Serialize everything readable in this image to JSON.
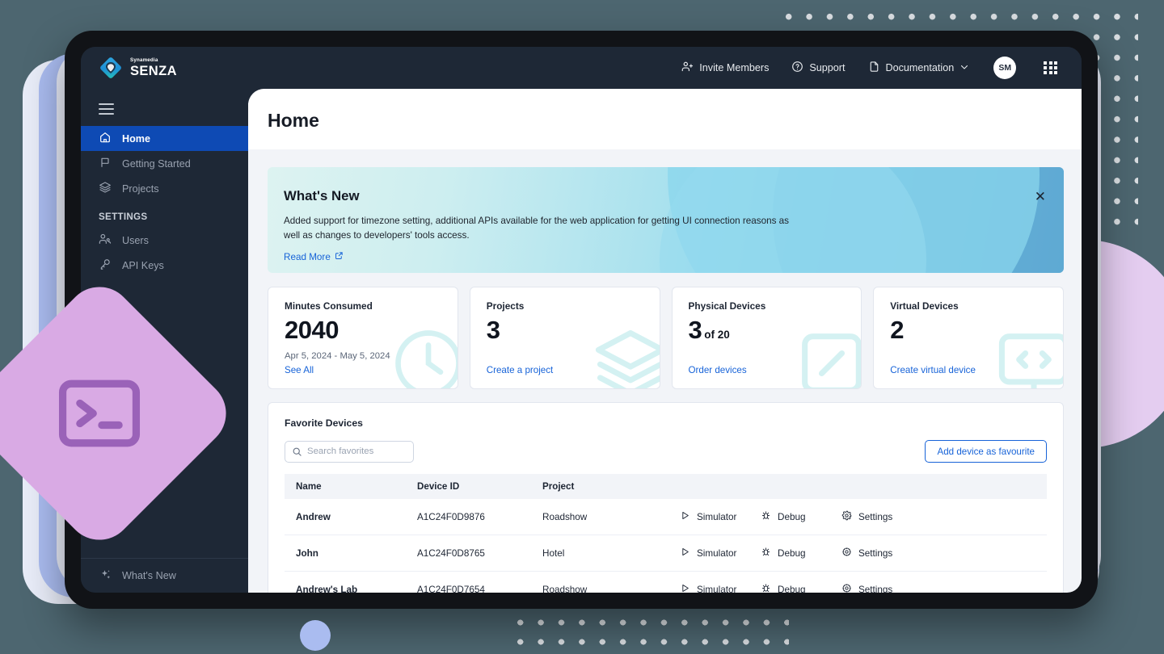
{
  "brand": {
    "sub": "Synamedia",
    "name": "SENZA"
  },
  "topnav": {
    "items": [
      {
        "label": "Invite Members",
        "icon": "user-plus-icon"
      },
      {
        "label": "Support",
        "icon": "question-circle-icon"
      },
      {
        "label": "Documentation",
        "icon": "document-icon"
      }
    ],
    "avatar_initials": "SM"
  },
  "sidebar": {
    "items": [
      {
        "label": "Home",
        "icon": "home-icon",
        "active": true
      },
      {
        "label": "Getting Started",
        "icon": "flag-icon",
        "active": false
      },
      {
        "label": "Projects",
        "icon": "layers-icon",
        "active": false
      }
    ],
    "section_label": "SETTINGS",
    "settings_items": [
      {
        "label": "Users",
        "icon": "users-icon"
      },
      {
        "label": "API Keys",
        "icon": "key-icon"
      }
    ],
    "bottom_item": {
      "label": "What's New",
      "icon": "sparkle-icon"
    }
  },
  "page": {
    "title": "Home"
  },
  "banner": {
    "heading": "What's New",
    "body": "Added support for timezone setting, additional APIs available for the web application for getting UI connection reasons as well as changes to developers' tools access.",
    "link": "Read More",
    "close": "✕"
  },
  "cards": [
    {
      "title": "Minutes Consumed",
      "value": "2040",
      "unit": "",
      "subtitle": "Apr 5, 2024 - May 5, 2024",
      "link": "See All",
      "art": "clock-icon"
    },
    {
      "title": "Projects",
      "value": "3",
      "unit": "",
      "subtitle": "",
      "link": "Create a project",
      "art": "layers-icon"
    },
    {
      "title": "Physical Devices",
      "value": "3",
      "unit": "of 20",
      "subtitle": "",
      "link": "Order devices",
      "art": "device-icon"
    },
    {
      "title": "Virtual Devices",
      "value": "2",
      "unit": "",
      "subtitle": "",
      "link": "Create virtual device",
      "art": "code-monitor-icon"
    }
  ],
  "favorites": {
    "title": "Favorite Devices",
    "search_placeholder": "Search favorites",
    "search_value": "",
    "add_button": "Add device as favourite",
    "columns": [
      "Name",
      "Device ID",
      "Project",
      "",
      "",
      ""
    ],
    "rows": [
      {
        "name": "Andrew",
        "device_id": "A1C24F0D9876",
        "project": "Roadshow",
        "simulator": "Simulator",
        "debug": "Debug",
        "settings": "Settings"
      },
      {
        "name": "John",
        "device_id": "A1C24F0D8765",
        "project": "Hotel",
        "simulator": "Simulator",
        "debug": "Debug",
        "settings": "Settings"
      },
      {
        "name": "Andrew's Lab",
        "device_id": "A1C24F0D7654",
        "project": "Roadshow",
        "simulator": "Simulator",
        "debug": "Debug",
        "settings": "Settings"
      }
    ]
  },
  "colors": {
    "page_background": "#4d6670",
    "sidebar": "#1e2836",
    "accent_blue": "#1763d8",
    "active_nav": "#0e4ab4",
    "diamond": "#d9aae4",
    "circle_right": "#e4cdf0",
    "circle_bottom": "#aabcf0"
  }
}
